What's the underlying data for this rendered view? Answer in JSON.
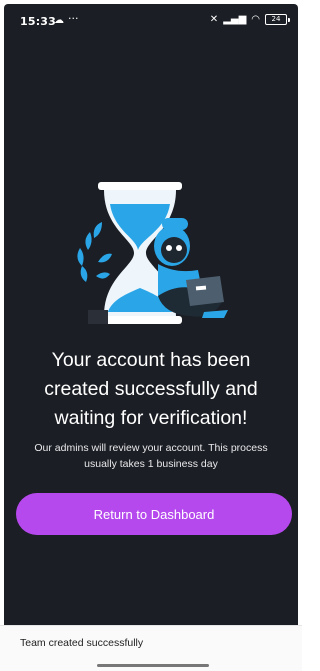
{
  "status_bar": {
    "time": "15:33",
    "battery_level": "24",
    "icons": [
      "cloud-icon",
      "more-dots-icon",
      "vibrate-icon",
      "signal-icon",
      "wifi-icon",
      "battery-icon"
    ]
  },
  "illustration": {
    "icon": "hourglass-person-laptop-illustration"
  },
  "message": {
    "title_line1": "Your account has been",
    "title_line2": "created successfully and",
    "title_line3": "waiting for verification!",
    "subtitle_line1": "Our admins will review your account. This process",
    "subtitle_line2": "usually takes 1 business day"
  },
  "cta": {
    "label": "Return to Dashboard"
  },
  "toast": {
    "text": "Team created successfully"
  },
  "colors": {
    "background": "#1b1e24",
    "accent": "#b649ee",
    "illustration_blue": "#2aa6e8"
  }
}
